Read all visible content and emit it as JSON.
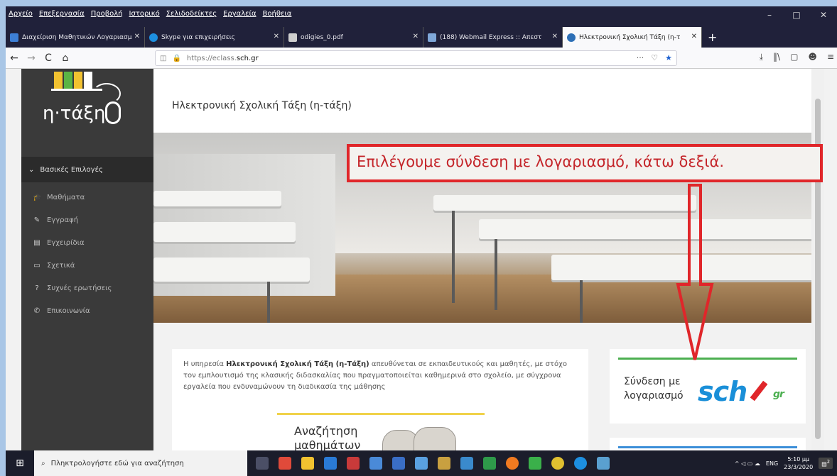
{
  "menubar": [
    "Αρχείο",
    "Επεξεργασία",
    "Προβολή",
    "Ιστορικό",
    "Σελιδοδείκτες",
    "Εργαλεία",
    "Βοήθεια"
  ],
  "window_controls": [
    "–",
    "□",
    "✕"
  ],
  "tabs": [
    {
      "label": "Διαχείριση Μαθητικών Λογαριασμ",
      "color": "#3d7fd6",
      "active": false
    },
    {
      "label": "Skype για επιχειρήσεις",
      "color": "#1d8fe0",
      "active": false
    },
    {
      "label": "odigies_0.pdf",
      "color": "#cfcfcf",
      "active": false
    },
    {
      "label": "(188) Webmail Express :: Απεστ",
      "color": "#7fa7d8",
      "active": false
    },
    {
      "label": "Ηλεκτρονική Σχολική Τάξη (η-τ",
      "color": "#2d6fb6",
      "active": true
    }
  ],
  "tab_close": "✕",
  "new_tab": "+",
  "nav": {
    "back": "←",
    "forward": "→",
    "reload": "C",
    "home": "⌂"
  },
  "url": {
    "prefix": "https://eclass.",
    "host": "sch.gr",
    "more": "···",
    "pocket": "♡",
    "star": "★"
  },
  "toolbar_icons": [
    "⤓",
    "‖\\",
    "▢",
    "☻",
    "≡"
  ],
  "sidebar": {
    "logo_text": "η·τάξη",
    "menu_header": "Βασικές Επιλογές",
    "items": [
      {
        "icon": "mortarboard-icon",
        "glyph": "🎓",
        "label": "Μαθήματα"
      },
      {
        "icon": "edit-icon",
        "glyph": "✎",
        "label": "Εγγραφή"
      },
      {
        "icon": "document-icon",
        "glyph": "▤",
        "label": "Εγχειρίδια"
      },
      {
        "icon": "card-icon",
        "glyph": "▭",
        "label": "Σχετικά"
      },
      {
        "icon": "question-icon",
        "glyph": "?",
        "label": "Συχνές ερωτήσεις"
      },
      {
        "icon": "phone-icon",
        "glyph": "✆",
        "label": "Επικοινωνία"
      }
    ]
  },
  "page": {
    "site_title": "Ηλεκτρονική Σχολική Τάξη (η-τάξη)",
    "callout": "Επιλέγουμε σύνδεση με λογαριασμό, κάτω δεξιά.",
    "info_prefix": "Η υπηρεσία ",
    "info_bold": "Ηλεκτρονική Σχολική Τάξη (η-Τάξη)",
    "info_rest": " απευθύνεται σε εκπαιδευτικούς και μαθητές, με στόχο τον εμπλουτισμό της κλασικής διδασκαλίας που πραγματοποιείται καθημερινά στο σχολείο, με σύγχρονα εργαλεία που ενδυναμώνουν τη διαδικασία της μάθησης",
    "search_label": "Αναζήτηση μαθημάτων",
    "login_text": "Σύνδεση με λογαριασμό",
    "login_logo": "sch",
    "login_logo_suffix": "gr"
  },
  "taskbar": {
    "search_placeholder": "Πληκτρολογήστε εδώ για αναζήτηση",
    "lang": "ENG",
    "time": "5:10 μμ",
    "date": "23/3/2020",
    "tray_glyphs": "^ ◁ ▭ ☁",
    "notification_count": "2"
  },
  "colors": {
    "callout_red": "#e0262a",
    "link_blue": "#1a8fd8",
    "green": "#4caf50"
  }
}
